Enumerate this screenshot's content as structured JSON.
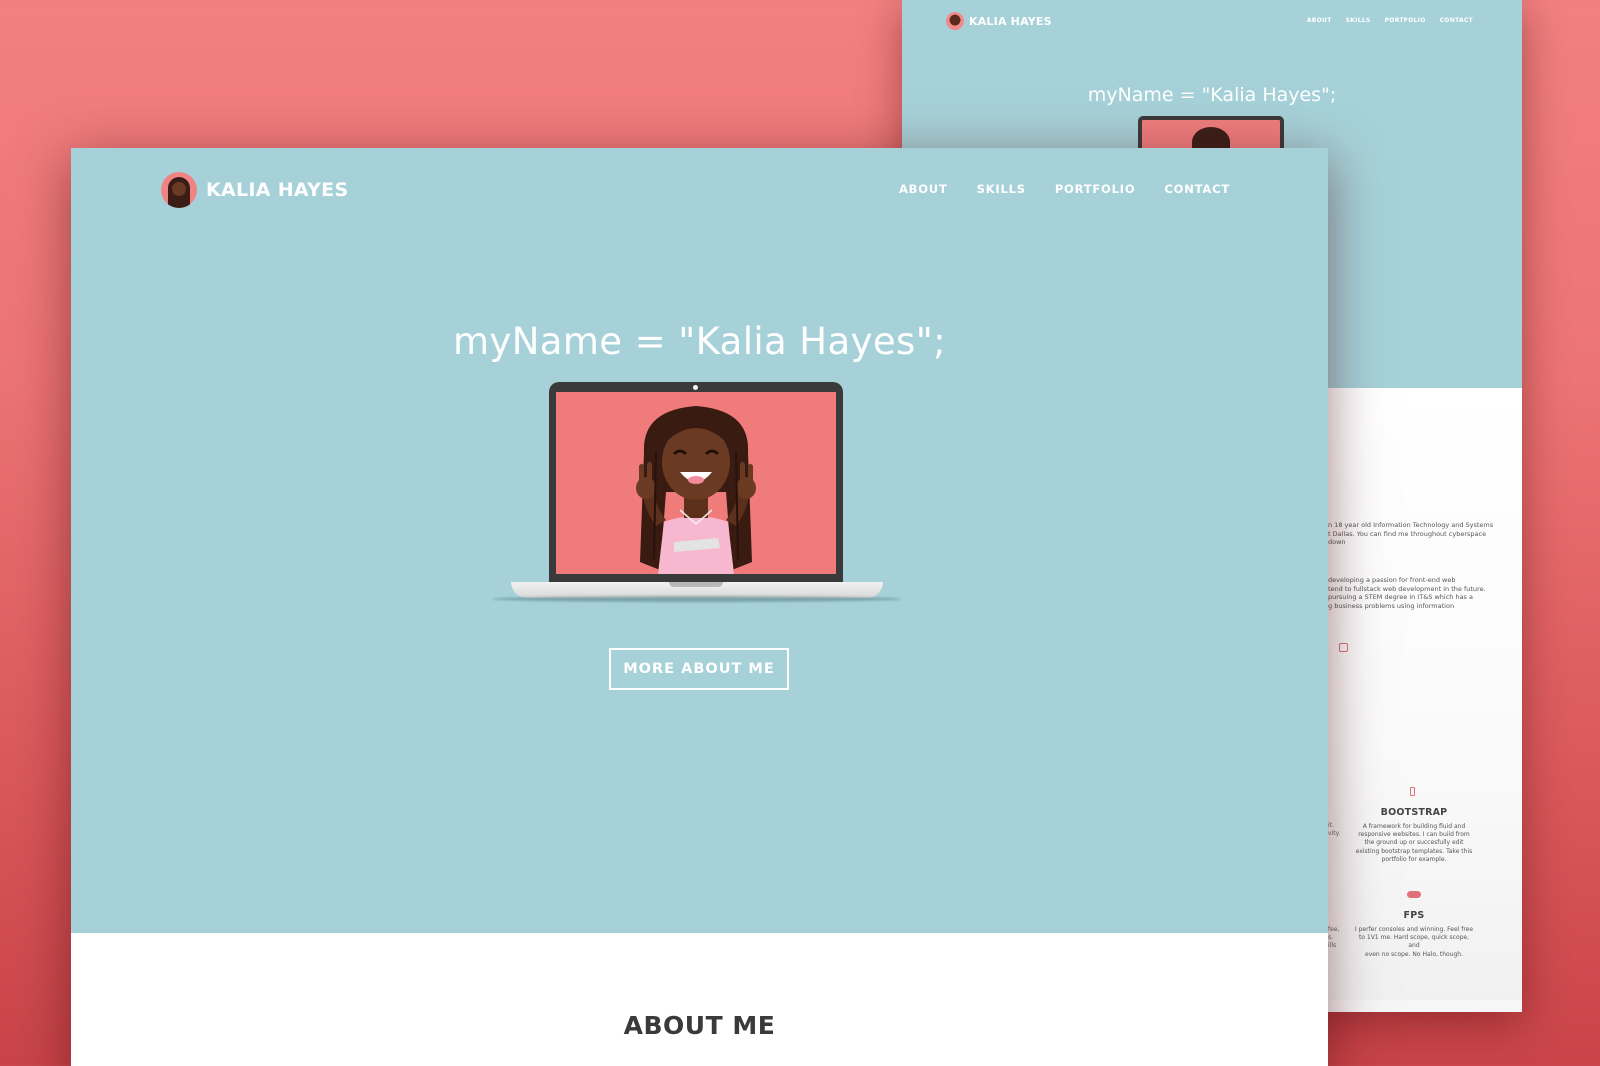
{
  "colors": {
    "background_top": "#f28080",
    "background_bottom": "#c94448",
    "hero": "#a6d1d8",
    "laptop_screen": "#f07b7b",
    "accent_pink": "#e0707a",
    "text_dark": "#3a3a3a"
  },
  "front": {
    "brand_name": "KALIA HAYES",
    "nav": [
      "ABOUT",
      "SKILLS",
      "PORTFOLIO",
      "CONTACT"
    ],
    "hero_title": "myName = \"Kalia Hayes\";",
    "cta_label": "MORE ABOUT ME",
    "about_heading": "ABOUT ME"
  },
  "back": {
    "brand_name": "KALIA HAYES",
    "nav": [
      "ABOUT",
      "SKILLS",
      "PORTFOLIO",
      "CONTACT"
    ],
    "hero_title": "myName = \"Kalia Hayes\";",
    "about_lines_1": [
      "n 18 year old Information Technology and Systems",
      "t Dallas. You can find me throughout cyberspace",
      "down"
    ],
    "about_lines_2": [
      "developing a passion for front-end web",
      "tend to fullstack web development in the future.",
      "pursuing a STEM degree in IT&S which has a",
      "g business problems using information"
    ],
    "skills": [
      {
        "icon": "phone-icon",
        "title": "BOOTSTRAP",
        "description": [
          "A framework for building fluid and",
          "responsive websites. I can build from",
          "the ground up or succesfully edit",
          "existing bootstrap templates. Take this",
          "portfolio for example."
        ]
      },
      {
        "icon": "gamepad-icon",
        "title": "FPS",
        "description": [
          "I perfer consoles and winning. Feel free",
          "to 1V1 me. Hard scope, quick scope, and",
          "even no scope. No Halo, though."
        ]
      }
    ],
    "left_fragments_1": [
      "it.",
      "",
      "vity."
    ],
    "left_fragments_2": [
      "fee,",
      "s.",
      "ills"
    ]
  }
}
